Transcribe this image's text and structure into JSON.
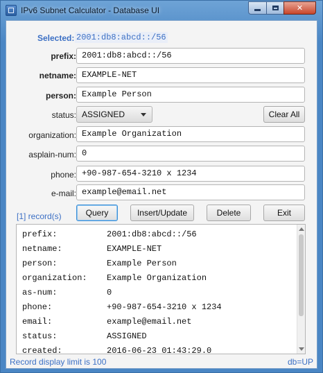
{
  "window": {
    "title": "IPv6 Subnet Calculator - Database UI",
    "app_icon": "app-window-icon",
    "controls": [
      "minimize-icon",
      "maximize-icon",
      "close-icon"
    ],
    "close_glyph": "✕"
  },
  "selected": {
    "label": "Selected:",
    "value": "2001:db8:abcd::/56"
  },
  "form": {
    "prefix": {
      "label": "prefix:",
      "value": "2001:db8:abcd::/56"
    },
    "netname": {
      "label": "netname:",
      "value": "EXAMPLE-NET"
    },
    "person": {
      "label": "person:",
      "value": "Example Person"
    },
    "status": {
      "label": "status:",
      "value": "ASSIGNED"
    },
    "organization": {
      "label": "organization:",
      "value": "Example Organization"
    },
    "asplain": {
      "label": "asplain-num:",
      "value": "0"
    },
    "phone": {
      "label": "phone:",
      "value": "+90-987-654-3210 x 1234"
    },
    "email": {
      "label": "e-mail:",
      "value": "example@email.net"
    }
  },
  "buttons": {
    "clear_all": "Clear All",
    "query": "Query",
    "insert_update": "Insert/Update",
    "delete": "Delete",
    "exit": "Exit"
  },
  "records_count": "[1] record(s)",
  "detail": [
    {
      "key": "prefix:",
      "value": "2001:db8:abcd::/56"
    },
    {
      "key": "netname:",
      "value": "EXAMPLE-NET"
    },
    {
      "key": "person:",
      "value": "Example Person"
    },
    {
      "key": "organization:",
      "value": "Example Organization"
    },
    {
      "key": "as-num:",
      "value": "0"
    },
    {
      "key": "phone:",
      "value": "+90-987-654-3210 x 1234"
    },
    {
      "key": "email:",
      "value": "example@email.net"
    },
    {
      "key": "status:",
      "value": "ASSIGNED"
    },
    {
      "key": "created:",
      "value": "2016-06-23 01:43:29.0"
    }
  ],
  "status_bar": {
    "left": "Record display limit is 100",
    "right": "db=UP"
  },
  "colors": {
    "accent": "#3b6fc4",
    "title_bar": "#4a86c4",
    "close_button": "#c7462c"
  }
}
